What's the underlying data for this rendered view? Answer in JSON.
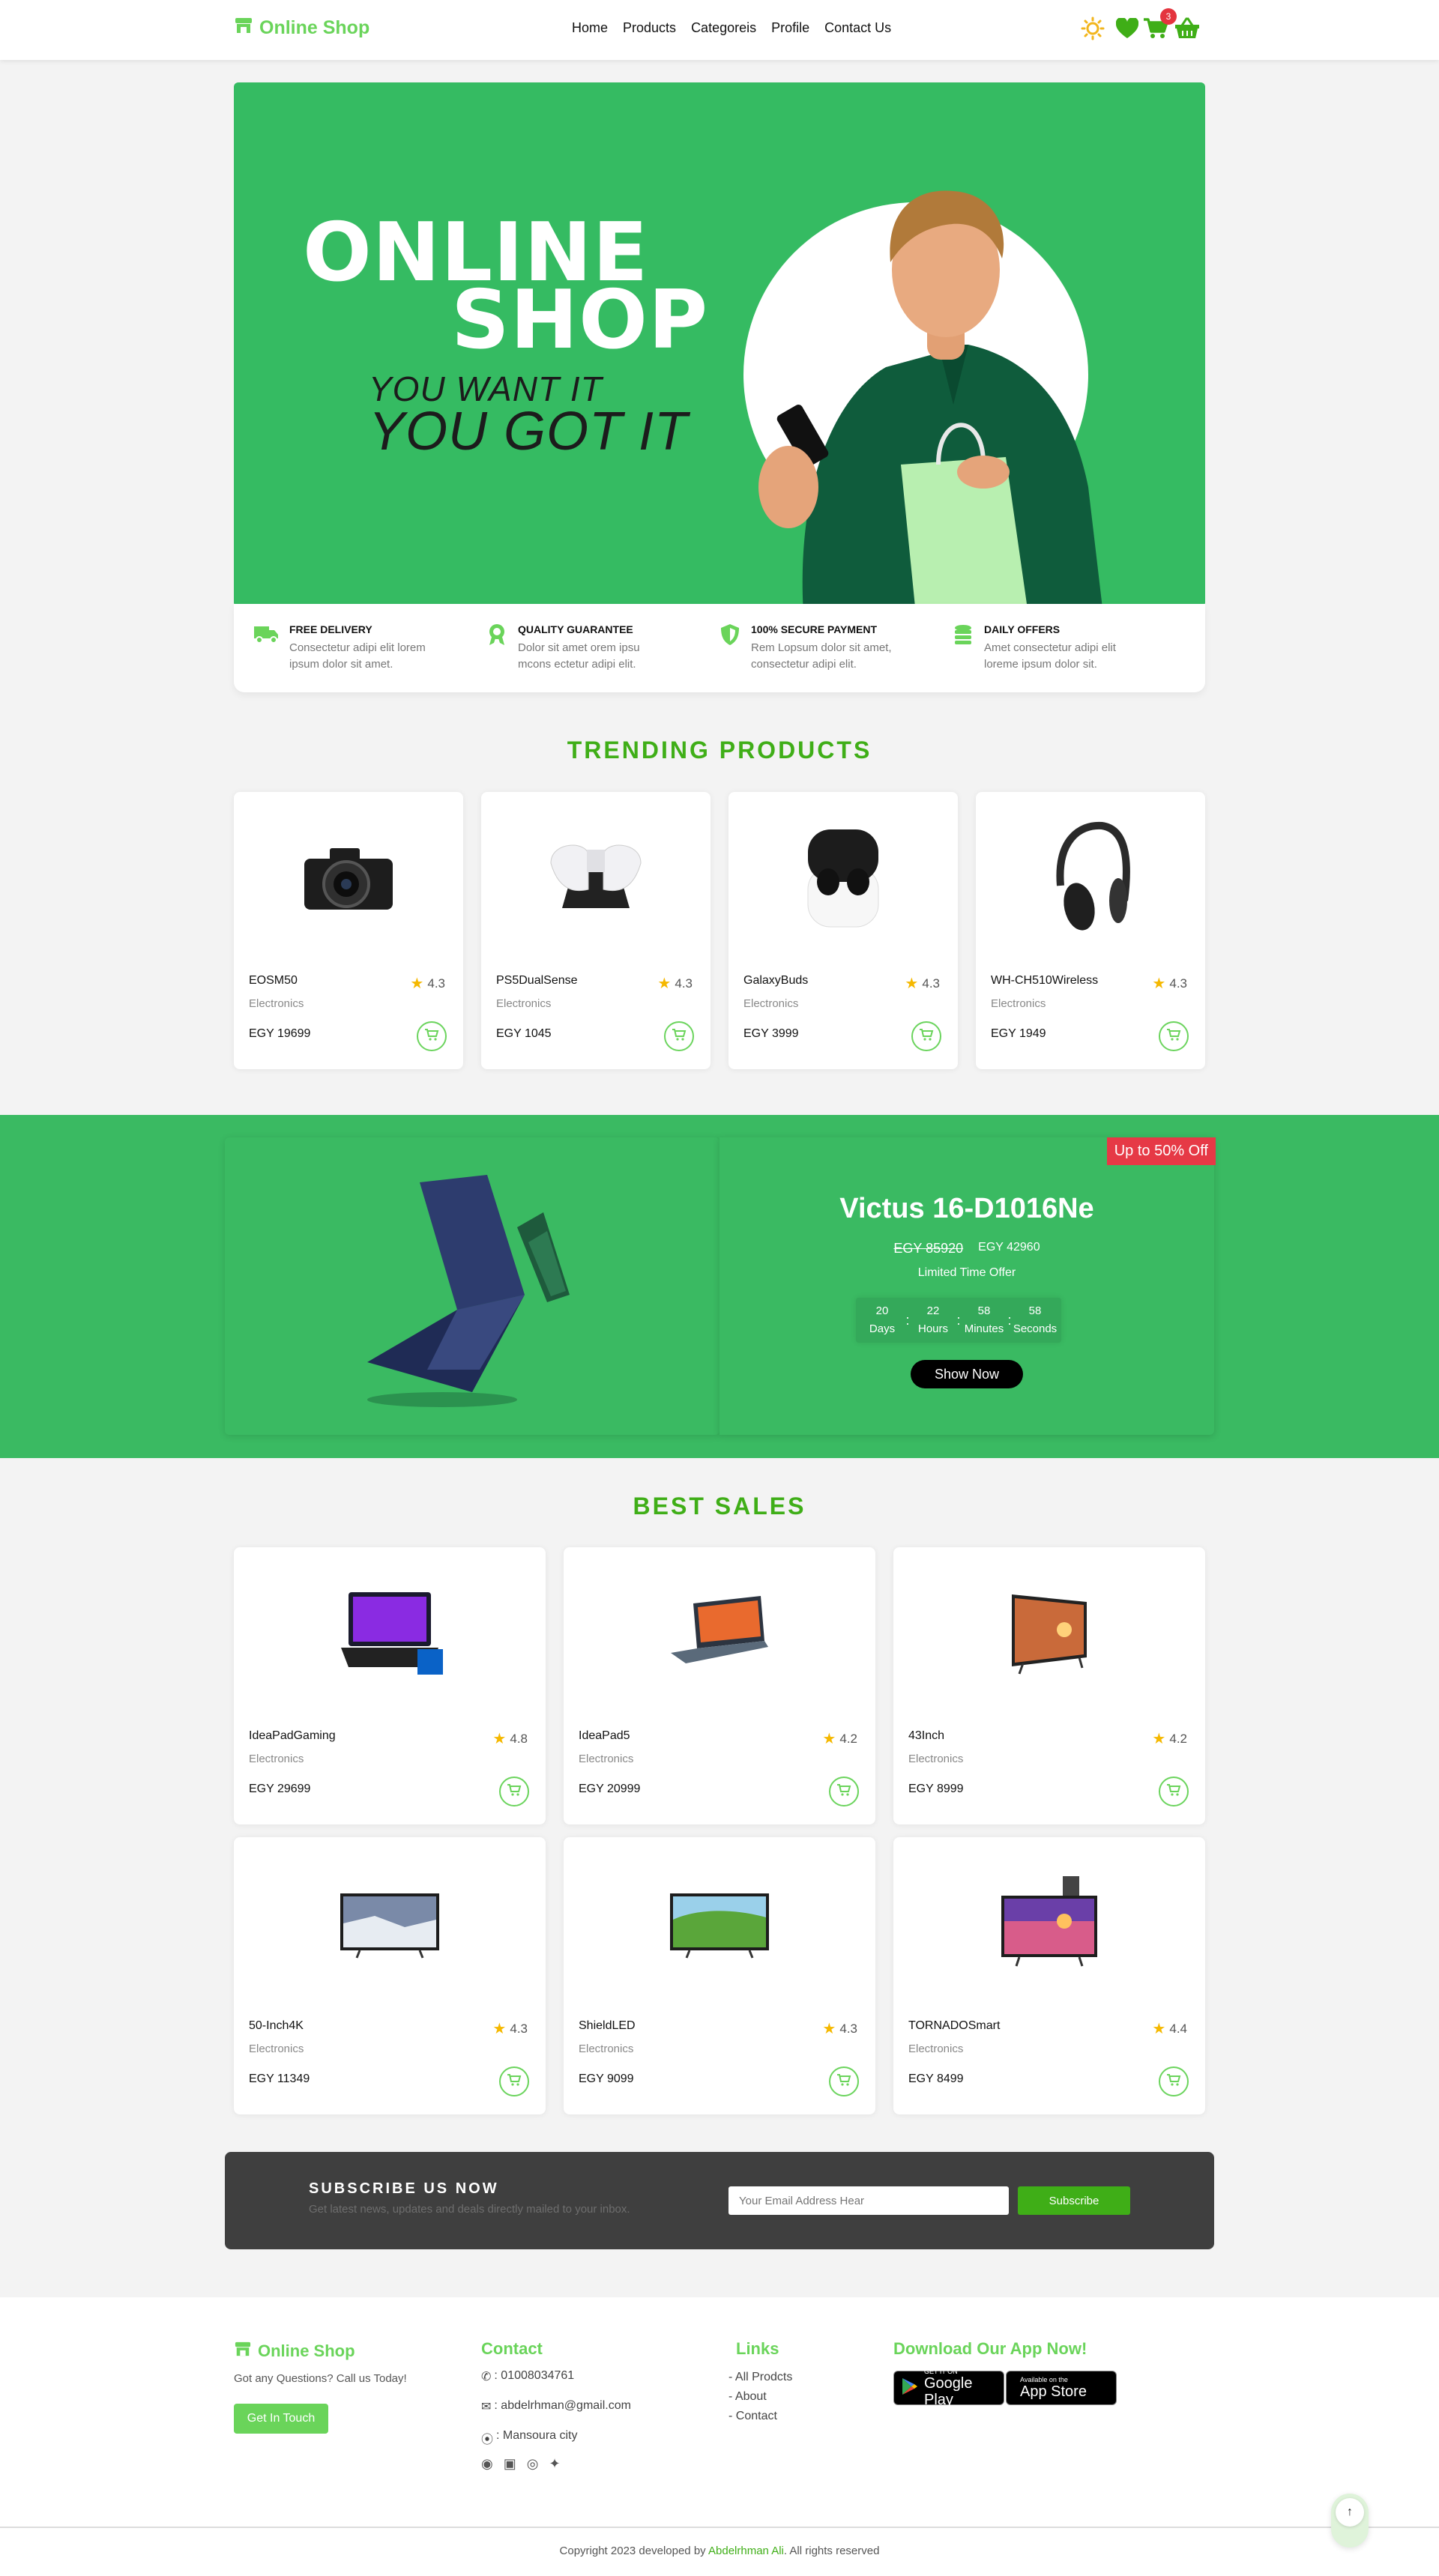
{
  "header": {
    "logo": "Online Shop",
    "nav": [
      "Home",
      "Products",
      "Categoreis",
      "Profile",
      "Contact Us"
    ],
    "cart_count": "3"
  },
  "hero": {
    "title_line1": "ONLINE",
    "title_line2": "SHOP",
    "tag_line1": "YOU WANT IT",
    "tag_line2": "YOU GOT IT"
  },
  "features": [
    {
      "title": "FREE DELIVERY",
      "text": "Consectetur adipi elit lorem ipsum dolor sit amet.",
      "icon": "truck-icon"
    },
    {
      "title": "QUALITY GUARANTEE",
      "text": "Dolor sit amet orem ipsu mcons ectetur adipi elit.",
      "icon": "award-icon"
    },
    {
      "title": "100% SECURE PAYMENT",
      "text": "Rem Lopsum dolor sit amet, consectetur adipi elit.",
      "icon": "shield-icon"
    },
    {
      "title": "DAILY OFFERS",
      "text": "Amet consectetur adipi elit loreme ipsum dolor sit.",
      "icon": "coins-icon"
    }
  ],
  "trending": {
    "title": "TRENDING PRODUCTS",
    "products": [
      {
        "name": "EOSM50",
        "rating": "4.3",
        "category": "Electronics",
        "price": "EGY 19699"
      },
      {
        "name": "PS5DualSense",
        "rating": "4.3",
        "category": "Electronics",
        "price": "EGY 1045"
      },
      {
        "name": "GalaxyBuds",
        "rating": "4.3",
        "category": "Electronics",
        "price": "EGY 3999"
      },
      {
        "name": "WH-CH510Wireless",
        "rating": "4.3",
        "category": "Electronics",
        "price": "EGY 1949"
      }
    ]
  },
  "offer": {
    "badge": "Up to 50% Off",
    "name": "Victus 16-D1016Ne",
    "old_price": "EGY 85920",
    "new_price": "EGY 42960",
    "label": "Limited Time Offer",
    "countdown": [
      {
        "value": "20",
        "unit": "Days"
      },
      {
        "value": "22",
        "unit": "Hours"
      },
      {
        "value": "58",
        "unit": "Minutes"
      },
      {
        "value": "58",
        "unit": "Seconds"
      }
    ],
    "button": "Show Now"
  },
  "best": {
    "title": "BEST SALES",
    "products": [
      {
        "name": "IdeaPadGaming",
        "rating": "4.8",
        "category": "Electronics",
        "price": "EGY 29699"
      },
      {
        "name": "IdeaPad5",
        "rating": "4.2",
        "category": "Electronics",
        "price": "EGY 20999"
      },
      {
        "name": "43Inch",
        "rating": "4.2",
        "category": "Electronics",
        "price": "EGY 8999"
      },
      {
        "name": "50-Inch4K",
        "rating": "4.3",
        "category": "Electronics",
        "price": "EGY 11349"
      },
      {
        "name": "ShieldLED",
        "rating": "4.3",
        "category": "Electronics",
        "price": "EGY 9099"
      },
      {
        "name": "TORNADOSmart",
        "rating": "4.4",
        "category": "Electronics",
        "price": "EGY 8499"
      }
    ]
  },
  "subscribe": {
    "title": "SUBSCRIBE US NOW",
    "text": "Get latest news, updates and deals directly mailed to your inbox.",
    "placeholder": "Your Email Address Hear",
    "button": "Subscribe"
  },
  "footer": {
    "brand": "Online Shop",
    "question": "Got any Questions? Call us Today!",
    "get_in_touch": "Get In Touch",
    "contact_title": "Contact",
    "phone": ": 01008034761",
    "email": ": abdelrhman@gmail.com",
    "address": ": Mansoura city",
    "links_title": "Links",
    "links": [
      "- All Prodcts",
      "- About",
      "- Contact"
    ],
    "app_title": "Download Our App Now!",
    "google_small": "GET IT ON",
    "google_big": "Google Play",
    "apple_small": "Available on the",
    "apple_big": "App Store",
    "copyright_pre": "Copyright 2023 developed by",
    "copyright_name": "Abdelrhman Ali",
    "copyright_post": ". All rights reserved"
  },
  "colors": {
    "brand_green": "#6ad45a",
    "hero_green": "#35bb62",
    "accent_green": "#3fae17",
    "red": "#e63946"
  }
}
